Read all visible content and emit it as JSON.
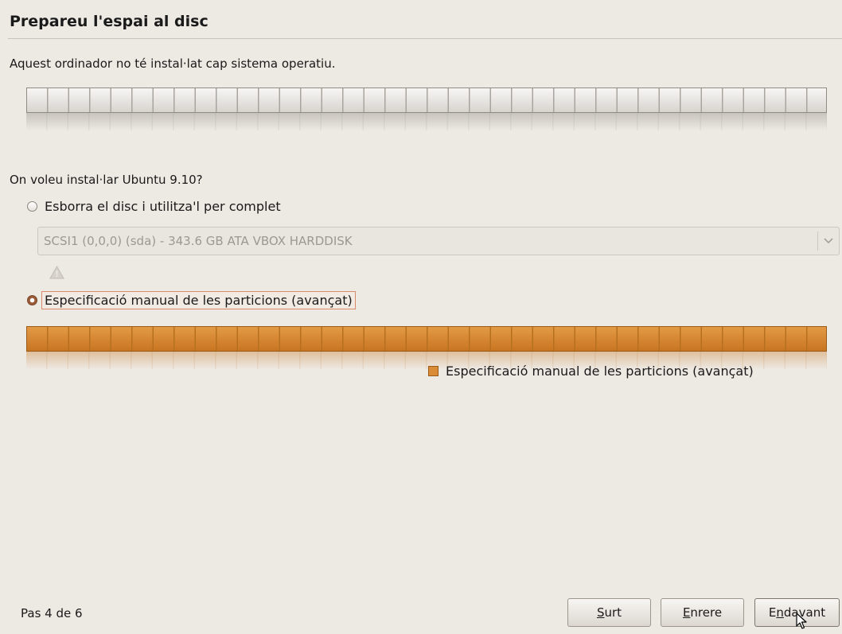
{
  "header": {
    "title": "Prepareu l'espai al disc",
    "subtitle": "Aquest ordinador no té instal·lat cap sistema operatiu."
  },
  "question": "On voleu instal·lar Ubuntu 9.10?",
  "options": {
    "erase": {
      "label": "Esborra el disc i utilitza'l per complet",
      "selected": false
    },
    "manual": {
      "label": "Especificació manual de les particions (avançat)",
      "selected": true
    }
  },
  "disk_select": {
    "value": "SCSI1 (0,0,0) (sda) - 343.6 GB ATA VBOX HARDDISK",
    "enabled": false
  },
  "legend": {
    "label": "Especificació manual de les particions (avançat)",
    "color": "#d98b36"
  },
  "footer": {
    "step": "Pas 4 de 6",
    "quit": {
      "mnemonic": "S",
      "rest": "urt"
    },
    "back": {
      "mnemonic": "E",
      "rest": "nrere"
    },
    "next": {
      "pre": "E",
      "mnemonic": "n",
      "rest": "davant"
    }
  },
  "colors": {
    "accent": "#d98b36",
    "background": "#ede9e3"
  },
  "icons": [
    "warning-icon",
    "chevron-down-icon",
    "mouse-cursor-icon"
  ]
}
